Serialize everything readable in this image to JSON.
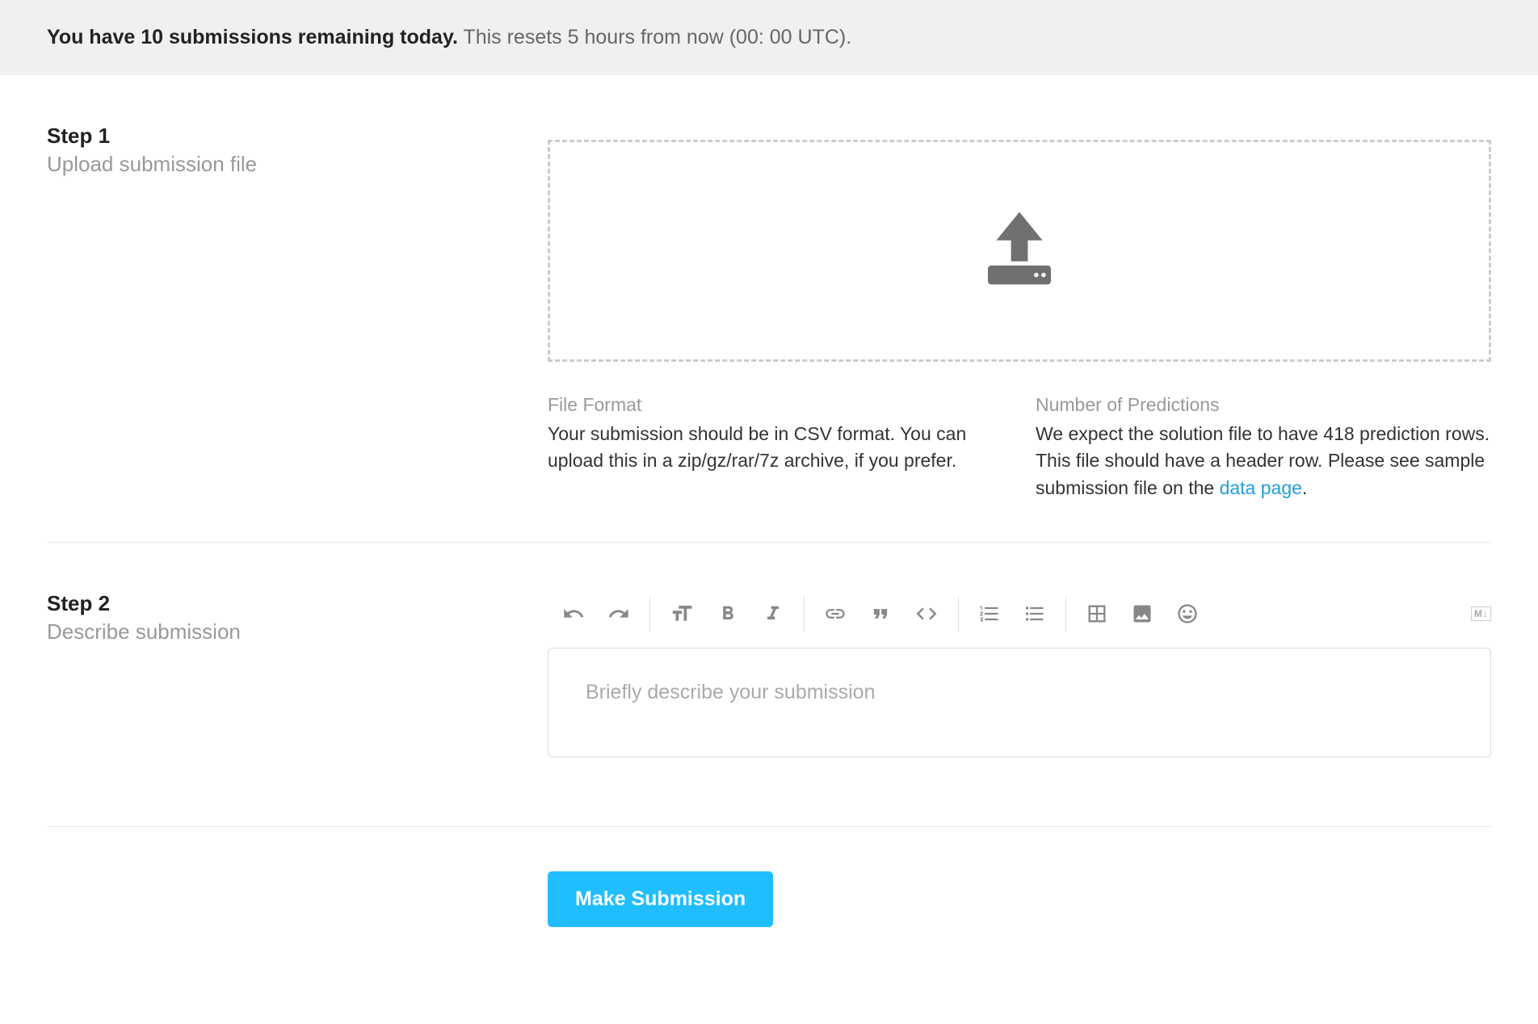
{
  "banner": {
    "bold_text": "You have 10 submissions remaining today.",
    "rest_text": " This resets 5 hours from now (00: 00 UTC)."
  },
  "step1": {
    "title": "Step 1",
    "subtitle": "Upload submission file",
    "file_format": {
      "heading": "File Format",
      "body": "Your submission should be in CSV format. You can upload this in a zip/gz/rar/7z archive, if you prefer."
    },
    "predictions": {
      "heading": "Number of Predictions",
      "body_before": "We expect the solution file to have 418 prediction rows. This file should have a header row. Please see sample submission file on the ",
      "link_text": "data page",
      "body_after": "."
    }
  },
  "step2": {
    "title": "Step 2",
    "subtitle": "Describe submission",
    "placeholder": "Briefly describe your submission",
    "markdown_badge": "M↓"
  },
  "submit": {
    "label": "Make Submission"
  }
}
